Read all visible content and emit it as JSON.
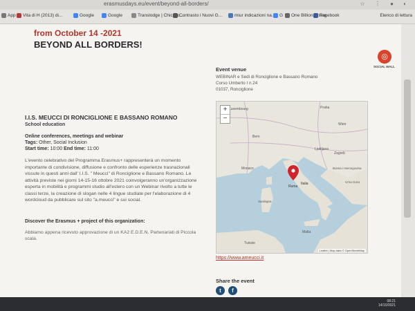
{
  "browser": {
    "url": "erasmusdays.eu/event/beyond-all-borders/",
    "bookmarks": [
      {
        "label": "App",
        "color": "#777777"
      },
      {
        "label": "Vita di H (2013) di...",
        "color": "#b33a3a"
      },
      {
        "label": "Google",
        "color": "#4285f4"
      },
      {
        "label": "Google",
        "color": "#4285f4"
      },
      {
        "label": "Translodge | Chicago...",
        "color": "#888888"
      },
      {
        "label": "Contrasto i Nuovi G...",
        "color": "#555555"
      },
      {
        "label": "miur indicazioni na...",
        "color": "#4a7ab5"
      },
      {
        "label": "G",
        "color": "#4285f4"
      },
      {
        "label": "One Billion Rising",
        "color": "#666666"
      },
      {
        "label": "Facebook",
        "color": "#3b5998"
      }
    ],
    "other_bookmarks": "Elenco di lettura"
  },
  "event": {
    "date_line": "from October 14 -2021",
    "title": "BEYOND ALL BORDERS!",
    "social_wall": "SOCIAL WALL",
    "organization": "I.I.S. MEUCCI DI RONCIGLIONE E BASSANO ROMANO",
    "org_type": "School education",
    "event_type": "Online conferences, meetings and webinar",
    "tags_label": "Tags:",
    "tags_value": "Other, Social Inclusion",
    "start_label": "Start time:",
    "start_value": "10:00",
    "end_label": "End time:",
    "end_value": "11:00",
    "description": "L'evento celebrativo del Programma Erasmus+ rappresenterà un momento importante di condivisione, diffusione e confronto delle esperienze trasnazionali vissute in questi anni dall' I.I.S. \" Meucci\" di Ronciglione e Bassano Romano. Le attività previste nei giorni 14-15-16 ottobre 2021 coinvolgeranno un'organizzazione esperta in mobilità e programmi studio all'estero con un Webinar rivolto a tutte le classi terze, la creazione di slogan nelle 4 lingue studiate per l'elaborazione di 4 wordcloud da pubblicare sul sito \"a.meucci\" e sui social.",
    "discover_heading": "Discover the Erasmus + project of this organization:",
    "discover_text": "Abbiamo appena ricevuto approvazione di un KA2 E.D.E.N. Partenariati di Piccola scala."
  },
  "venue": {
    "heading": "Event venue",
    "line1": "WEBINAR e Sedi di Ronciglione e Bassano Romano",
    "line2": "Corso Umberto I n.24",
    "line3": "01037, Ronciglione",
    "website": "https://www.ameucci.it",
    "map": {
      "zoom_in": "+",
      "zoom_out": "−",
      "attribution": "Leaflet | Map data © OpenStreetMap",
      "labels": [
        "Luxembourg",
        "Praha",
        "Wien",
        "Bern",
        "Ljubljana",
        "Zagreb",
        "Bosna i Hercegovina",
        "Crna Gora",
        "Roma",
        "Italia",
        "Monaco",
        "Tunisie",
        "Malta",
        "Sardegna"
      ]
    }
  },
  "share": {
    "heading": "Share the event",
    "icons": [
      "twitter-icon",
      "facebook-icon"
    ]
  },
  "tray": {
    "time": "08:21",
    "date": "14/10/2021"
  }
}
